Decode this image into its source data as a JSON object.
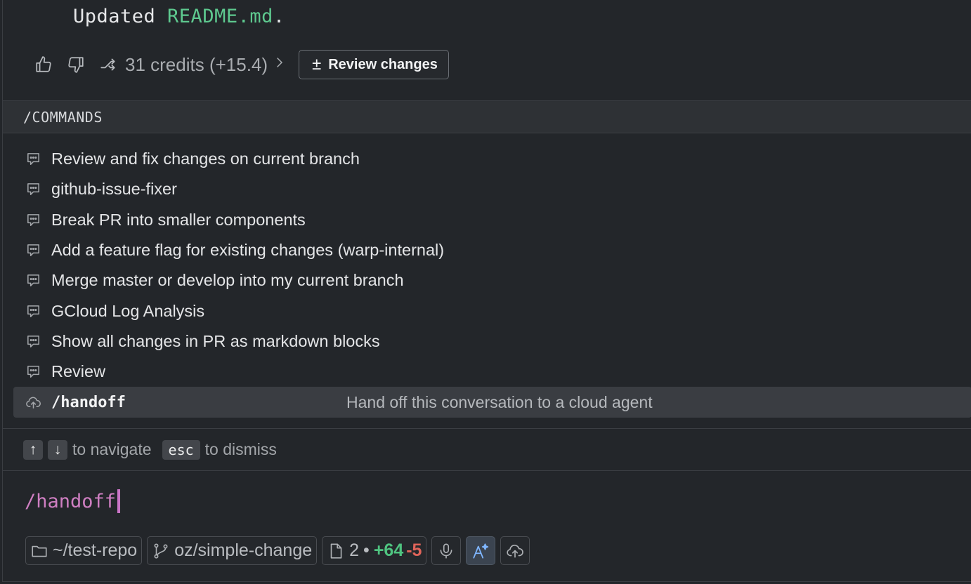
{
  "message": {
    "prefix": "Updated ",
    "file": "README.md",
    "suffix": "."
  },
  "feedback": {
    "thumbs_up_icon": "thumbs-up-icon",
    "thumbs_down_icon": "thumbs-down-icon",
    "fork_icon": "fork-icon",
    "credits": "31 credits (+15.4)",
    "credits_chevron": ">",
    "review_label": "Review changes",
    "review_symbol": "±"
  },
  "commands": {
    "header": "/COMMANDS",
    "items": [
      {
        "label": "Review and fix changes on current branch",
        "icon": "chat-icon"
      },
      {
        "label": "github-issue-fixer",
        "icon": "chat-icon"
      },
      {
        "label": "Break PR into smaller components",
        "icon": "chat-icon"
      },
      {
        "label": "Add a feature flag for existing changes (warp-internal)",
        "icon": "chat-icon"
      },
      {
        "label": "Merge master or develop into my current branch",
        "icon": "chat-icon"
      },
      {
        "label": "GCloud Log Analysis",
        "icon": "chat-icon"
      },
      {
        "label": "Show all changes in PR as markdown blocks",
        "icon": "chat-icon"
      },
      {
        "label": "Review",
        "icon": "chat-icon"
      }
    ],
    "selected": {
      "label": "/handoff",
      "description": "Hand off this conversation to a cloud agent",
      "icon": "cloud-upload-icon"
    }
  },
  "hints": {
    "up_key": "↑",
    "down_key": "↓",
    "navigate": "to navigate",
    "esc_key": "esc",
    "dismiss": "to dismiss"
  },
  "input": {
    "value": "/handoff"
  },
  "status": {
    "directory": "~/test-repo",
    "branch": "oz/simple-change",
    "files_count": "2",
    "separator": "•",
    "additions": "+64",
    "deletions": "-5",
    "colors": {
      "additions": "#4fc480",
      "deletions": "#e0645a",
      "input": "#cf7fc2"
    }
  }
}
